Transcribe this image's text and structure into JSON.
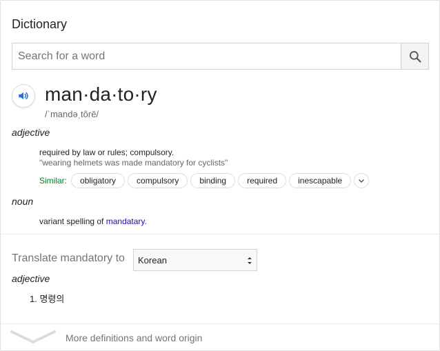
{
  "card": {
    "title": "Dictionary"
  },
  "search": {
    "placeholder": "Search for a word"
  },
  "entry": {
    "headword": "man·da·to·ry",
    "phonetic": "/ˈmandəˌtôrē/",
    "senses": [
      {
        "part_of_speech": "adjective",
        "definition": "required by law or rules; compulsory.",
        "example": "\"wearing helmets was made mandatory for cyclists\"",
        "similar_label": "Similar:",
        "similar": [
          "obligatory",
          "compulsory",
          "binding",
          "required",
          "inescapable"
        ]
      },
      {
        "part_of_speech": "noun",
        "definition_prefix": "variant spelling of ",
        "definition_link": "mandatary",
        "definition_suffix": "."
      }
    ]
  },
  "translate": {
    "label": "Translate mandatory to",
    "language": "Korean",
    "part_of_speech": "adjective",
    "items": [
      "1. 명령의"
    ]
  },
  "footer": {
    "more_label": "More definitions and word origin"
  },
  "colors": {
    "similar_label": "#0a7a2b",
    "link": "#1a0dab",
    "audio_icon": "#1a73e8"
  }
}
